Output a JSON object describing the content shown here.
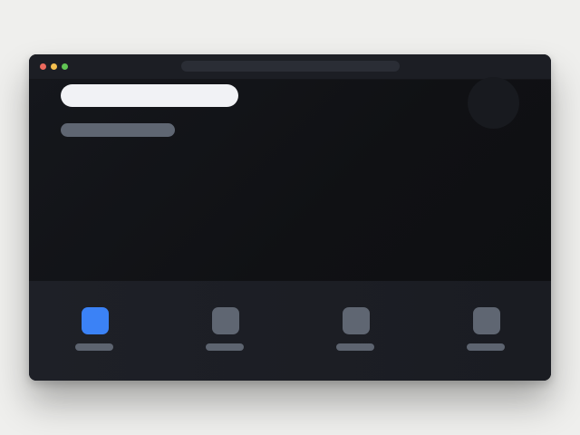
{
  "window": {
    "controls": [
      {
        "name": "close",
        "color": "#ec6a5e"
      },
      {
        "name": "minimize",
        "color": "#f4bf4f"
      },
      {
        "name": "maximize",
        "color": "#61c554"
      }
    ],
    "address_bar": ""
  },
  "content": {
    "title": "",
    "subtitle": "",
    "avatar_icon": "avatar-circle"
  },
  "dock": {
    "items": [
      {
        "icon": "app-tile-icon",
        "label": "",
        "active": true,
        "color": "#3b82f6"
      },
      {
        "icon": "app-tile-icon",
        "label": "",
        "active": false,
        "color": "#5f6672"
      },
      {
        "icon": "app-tile-icon",
        "label": "",
        "active": false,
        "color": "#5f6672"
      },
      {
        "icon": "app-tile-icon",
        "label": "",
        "active": false,
        "color": "#5f6672"
      }
    ]
  },
  "colors": {
    "window_bg": "#111216",
    "accent": "#3b82f6",
    "muted": "#5f6672"
  }
}
